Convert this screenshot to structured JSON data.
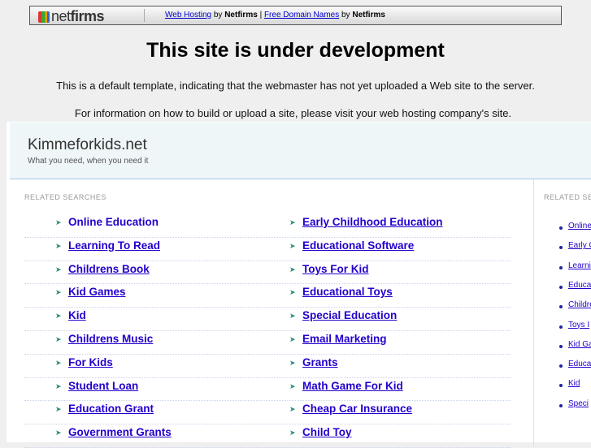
{
  "banner": {
    "logo": "netfirms",
    "link1": "Web Hosting",
    "by1": "by",
    "brand1": "Netfirms",
    "divider": "|",
    "link2": "Free Domain Names",
    "by2": "by",
    "brand2": "Netfirms"
  },
  "title": "This site is under development",
  "para1": "This is a default template, indicating that the webmaster has not yet uploaded a Web site to the server.",
  "para2": "For information on how to build or upload a site, please visit your web hosting company's site.",
  "site": {
    "name": "Kimmeforkids.net",
    "tagline": "What you need, when you need it"
  },
  "main": {
    "heading": "RELATED SEARCHES",
    "left": [
      "Online Education",
      "Learning To Read",
      "Childrens Book",
      "Kid Games",
      "Kid",
      "Childrens Music",
      "For Kids",
      "Student Loan",
      "Education Grant",
      "Government Grants"
    ],
    "right": [
      "Early Childhood Education",
      "Educational Software",
      "Toys For Kid",
      "Educational Toys",
      "Special Education",
      "Email Marketing",
      "Grants",
      "Math Game For Kid",
      "Cheap Car Insurance",
      "Child Toy"
    ]
  },
  "side": {
    "heading": "RELATED SE",
    "items": [
      "Online",
      "Early C",
      "Learni",
      "Educa",
      "Childre",
      "Toys I",
      "Kid Ga",
      "Educa",
      "Kid",
      "Speci"
    ]
  },
  "colors": {
    "link": "#2200cc",
    "bullet": "#2a8a7a",
    "header_bg": "#eef6f8"
  }
}
